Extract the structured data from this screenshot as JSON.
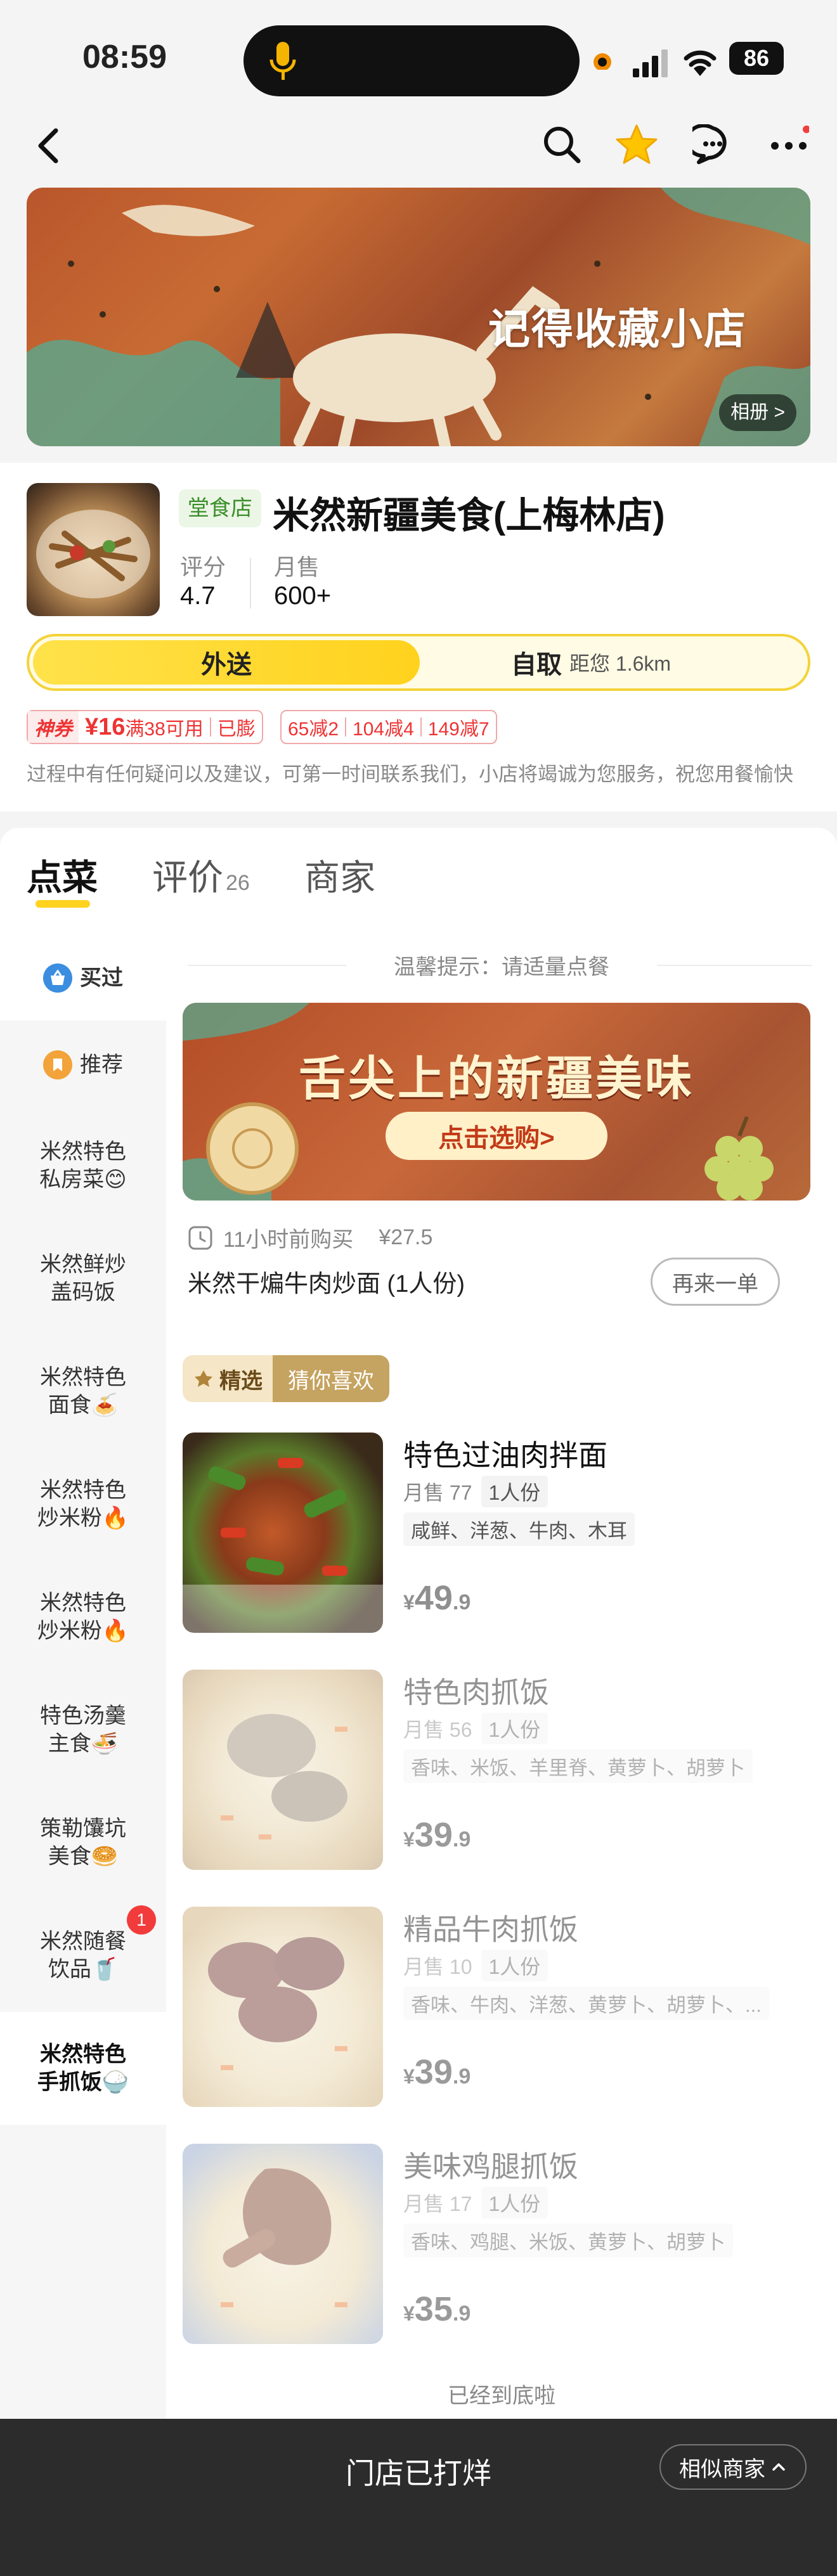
{
  "status_bar": {
    "time": "08:59",
    "battery": "86"
  },
  "nav": {
    "back_icon": "chevron-left-icon",
    "search_icon": "search-icon",
    "favorite_icon": "star-icon",
    "chat_icon": "message-icon",
    "more_icon": "more-icon"
  },
  "banner": {
    "title": "记得收藏小店",
    "album_label": "相册 >"
  },
  "shop": {
    "tag": "堂食店",
    "name": "米然新疆美食(上梅林店)",
    "rating_label": "评分",
    "rating_value": "4.7",
    "sales_label": "月售",
    "sales_value": "600+"
  },
  "mode": {
    "delivery": "外送",
    "pickup": "自取",
    "distance": "距您 1.6km"
  },
  "promos": {
    "coupon_tag": "神券",
    "coupon_amount": "¥16",
    "coupon_condition": "满38可用",
    "coupon_status": "已膨",
    "discounts": [
      "65减2",
      "104减4",
      "149减7"
    ]
  },
  "notice": "过程中有任何疑问以及建议，可第一时间联系我们，小店将竭诚为您服务，祝您用餐愉快",
  "tabs": [
    {
      "label": "点菜",
      "count": ""
    },
    {
      "label": "评价",
      "count": "26"
    },
    {
      "label": "商家",
      "count": ""
    }
  ],
  "sidebar": [
    {
      "label": "买过",
      "icon": "basket-icon"
    },
    {
      "label": "推荐",
      "icon": "bookmark-icon"
    },
    {
      "label": "米然特色 私房菜😊",
      "badge": ""
    },
    {
      "label": "米然鲜炒 盖码饭",
      "badge": ""
    },
    {
      "label": "米然特色 面食🍝",
      "badge": ""
    },
    {
      "label": "米然特色 炒米粉🔥",
      "badge": ""
    },
    {
      "label": "米然特色 炒米粉🔥",
      "badge": ""
    },
    {
      "label": "特色汤羹 主食🍜",
      "badge": ""
    },
    {
      "label": "策勒馕坑 美食🥯",
      "badge": ""
    },
    {
      "label": "米然随餐 饮品🥤",
      "badge": "1"
    },
    {
      "label": "米然特色 手抓饭🍚",
      "badge": ""
    }
  ],
  "tip": "温馨提示：请适量点餐",
  "promo_banner": {
    "title": "舌尖上的新疆美味",
    "cta": "点击选购>"
  },
  "recent": {
    "time": "11小时前购买",
    "price": "¥27.5",
    "name": "米然干煸牛肉炒面 (1人份)",
    "reorder": "再来一单"
  },
  "picks": {
    "label_a": "精选",
    "label_b": "猜你喜欢"
  },
  "dishes": [
    {
      "name": "特色过油肉拌面",
      "sold": "月售 77",
      "portion": "1人份",
      "tags": "咸鲜、洋葱、牛肉、木耳",
      "cur": "¥",
      "int": "49",
      "dec": ".9"
    },
    {
      "name": "特色肉抓饭",
      "sold": "月售 56",
      "portion": "1人份",
      "tags": "香味、米饭、羊里脊、黄萝卜、胡萝卜",
      "cur": "¥",
      "int": "39",
      "dec": ".9"
    },
    {
      "name": "精品牛肉抓饭",
      "sold": "月售 10",
      "portion": "1人份",
      "tags": "香味、牛肉、洋葱、黄萝卜、胡萝卜、...",
      "cur": "¥",
      "int": "39",
      "dec": ".9"
    },
    {
      "name": "美味鸡腿抓饭",
      "sold": "月售 17",
      "portion": "1人份",
      "tags": "香味、鸡腿、米饭、黄萝卜、胡萝卜",
      "cur": "¥",
      "int": "35",
      "dec": ".9"
    }
  ],
  "end_text": "已经到底啦",
  "bottom": {
    "closed_text": "门店已打烊",
    "similar": "相似商家"
  },
  "colors": {
    "accent": "#ffd21d",
    "promo_red": "#e33333",
    "closed_bar": "#2c2c2c"
  }
}
